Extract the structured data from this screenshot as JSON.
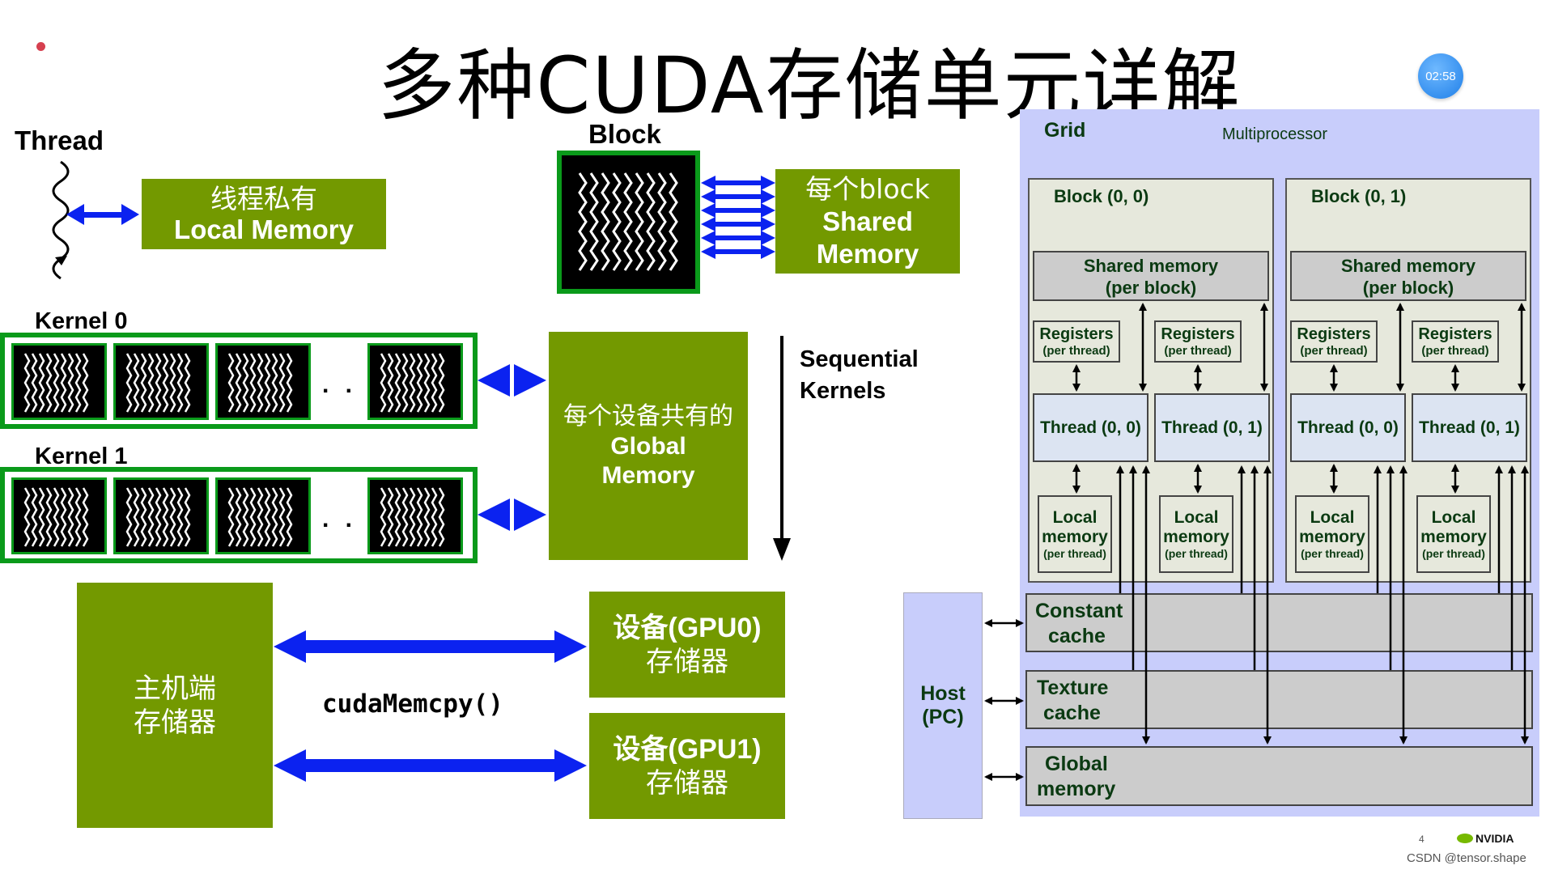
{
  "title": "多种CUDA存储单元详解",
  "timer": "02:58",
  "colors": {
    "nvidia_green": "#739900",
    "border_green": "#0a9a1a",
    "arrow_blue": "#0b22f0",
    "grid_bg": "#c8cdfb",
    "text_dark_green": "#0b3a12"
  },
  "left": {
    "thread_label": "Thread",
    "local_memory": {
      "cn": "线程私有",
      "en": "Local Memory"
    },
    "block_label": "Block",
    "shared_memory": {
      "cn": "每个block",
      "en1": "Shared",
      "en2": "Memory"
    },
    "kernels": [
      {
        "label": "Kernel 0",
        "ellipsis": ". . ."
      },
      {
        "label": "Kernel 1",
        "ellipsis": ". . ."
      }
    ],
    "global_memory": {
      "cn": "每个设备共有的",
      "en1": "Global",
      "en2": "Memory"
    },
    "sequential": {
      "line1": "Sequential",
      "line2": "Kernels"
    },
    "host_storage": {
      "line1": "主机端",
      "line2": "存储器"
    },
    "memcpy": "cudaMemcpy()",
    "gpu0": {
      "line1": "设备(GPU0)",
      "line2": "存储器"
    },
    "gpu1": {
      "line1": "设备(GPU1)",
      "line2": "存储器"
    }
  },
  "right": {
    "grid_label": "Grid",
    "multiprocessor": "Multiprocessor",
    "blocks": [
      {
        "label": "Block (0, 0)",
        "shared": "Shared memory",
        "shared_sub": "(per block)",
        "threads": [
          {
            "label": "Thread (0, 0)",
            "reg": "Registers",
            "reg_sub": "(per thread)",
            "local1": "Local",
            "local2": "memory",
            "local_sub": "(per thread)"
          },
          {
            "label": "Thread (0, 1)",
            "reg": "Registers",
            "reg_sub": "(per thread)",
            "local1": "Local",
            "local2": "memory",
            "local_sub": "(per thread)"
          }
        ]
      },
      {
        "label": "Block (0, 1)",
        "shared": "Shared memory",
        "shared_sub": "(per block)",
        "threads": [
          {
            "label": "Thread (0, 0)",
            "reg": "Registers",
            "reg_sub": "(per thread)",
            "local1": "Local",
            "local2": "memory",
            "local_sub": "(per thread)"
          },
          {
            "label": "Thread (0, 1)",
            "reg": "Registers",
            "reg_sub": "(per thread)",
            "local1": "Local",
            "local2": "memory",
            "local_sub": "(per thread)"
          }
        ]
      }
    ],
    "host": {
      "line1": "Host",
      "line2": "(PC)"
    },
    "constant_cache": {
      "line1": "Constant",
      "line2": "cache"
    },
    "texture_cache": {
      "line1": "Texture",
      "line2": "cache"
    },
    "global_memory": {
      "line1": "Global",
      "line2": "memory"
    }
  },
  "footer": {
    "page_number": "4",
    "logo": "NVIDIA",
    "watermark": "CSDN @tensor.shape"
  }
}
